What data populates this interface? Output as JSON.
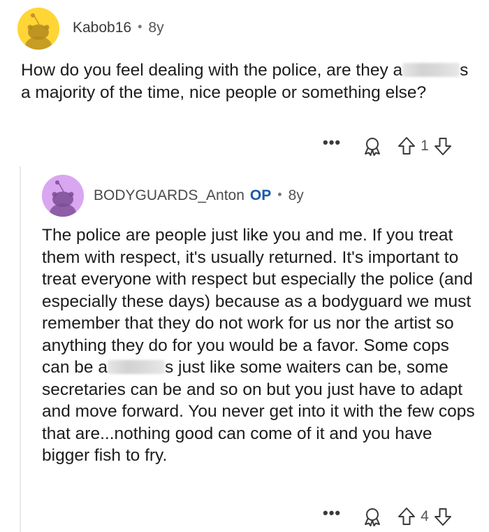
{
  "top_comment": {
    "author": "Kabob16",
    "separator": "•",
    "age": "8y",
    "text_before": "How do you feel dealing with the police, are they a",
    "text_after": "s a majority of the time, nice people or something else?",
    "more_label": "•••",
    "score": "1"
  },
  "reply": {
    "author": "BODYGUARDS_Anton",
    "op_badge": "OP",
    "separator": "•",
    "age": "8y",
    "text_before": "The police are people just like you and me.  If you treat them with respect, it's usually returned.  It's important to treat everyone with respect but especially the police (and especially these days) because as a bodyguard we must remember that they do not work for us nor the artist so anything they do for you would be a favor.  Some cops can be a",
    "text_after": "s just like some waiters can be, some secretaries can be and so on but you just have to adapt and move forward.  You never get into it with the few cops that are...nothing good can come of it and you have bigger fish to fry.",
    "more_label": "•••",
    "score": "4"
  },
  "colors": {
    "top_avatar_bg": "#ffd635",
    "reply_avatar_bg": "#d9a7f2",
    "op_badge": "#1a5aa8",
    "text": "#1c1c1c"
  },
  "icons": [
    "snoo-avatar-icon",
    "award-icon",
    "upvote-arrow-icon",
    "downvote-arrow-icon",
    "more-options-icon"
  ]
}
